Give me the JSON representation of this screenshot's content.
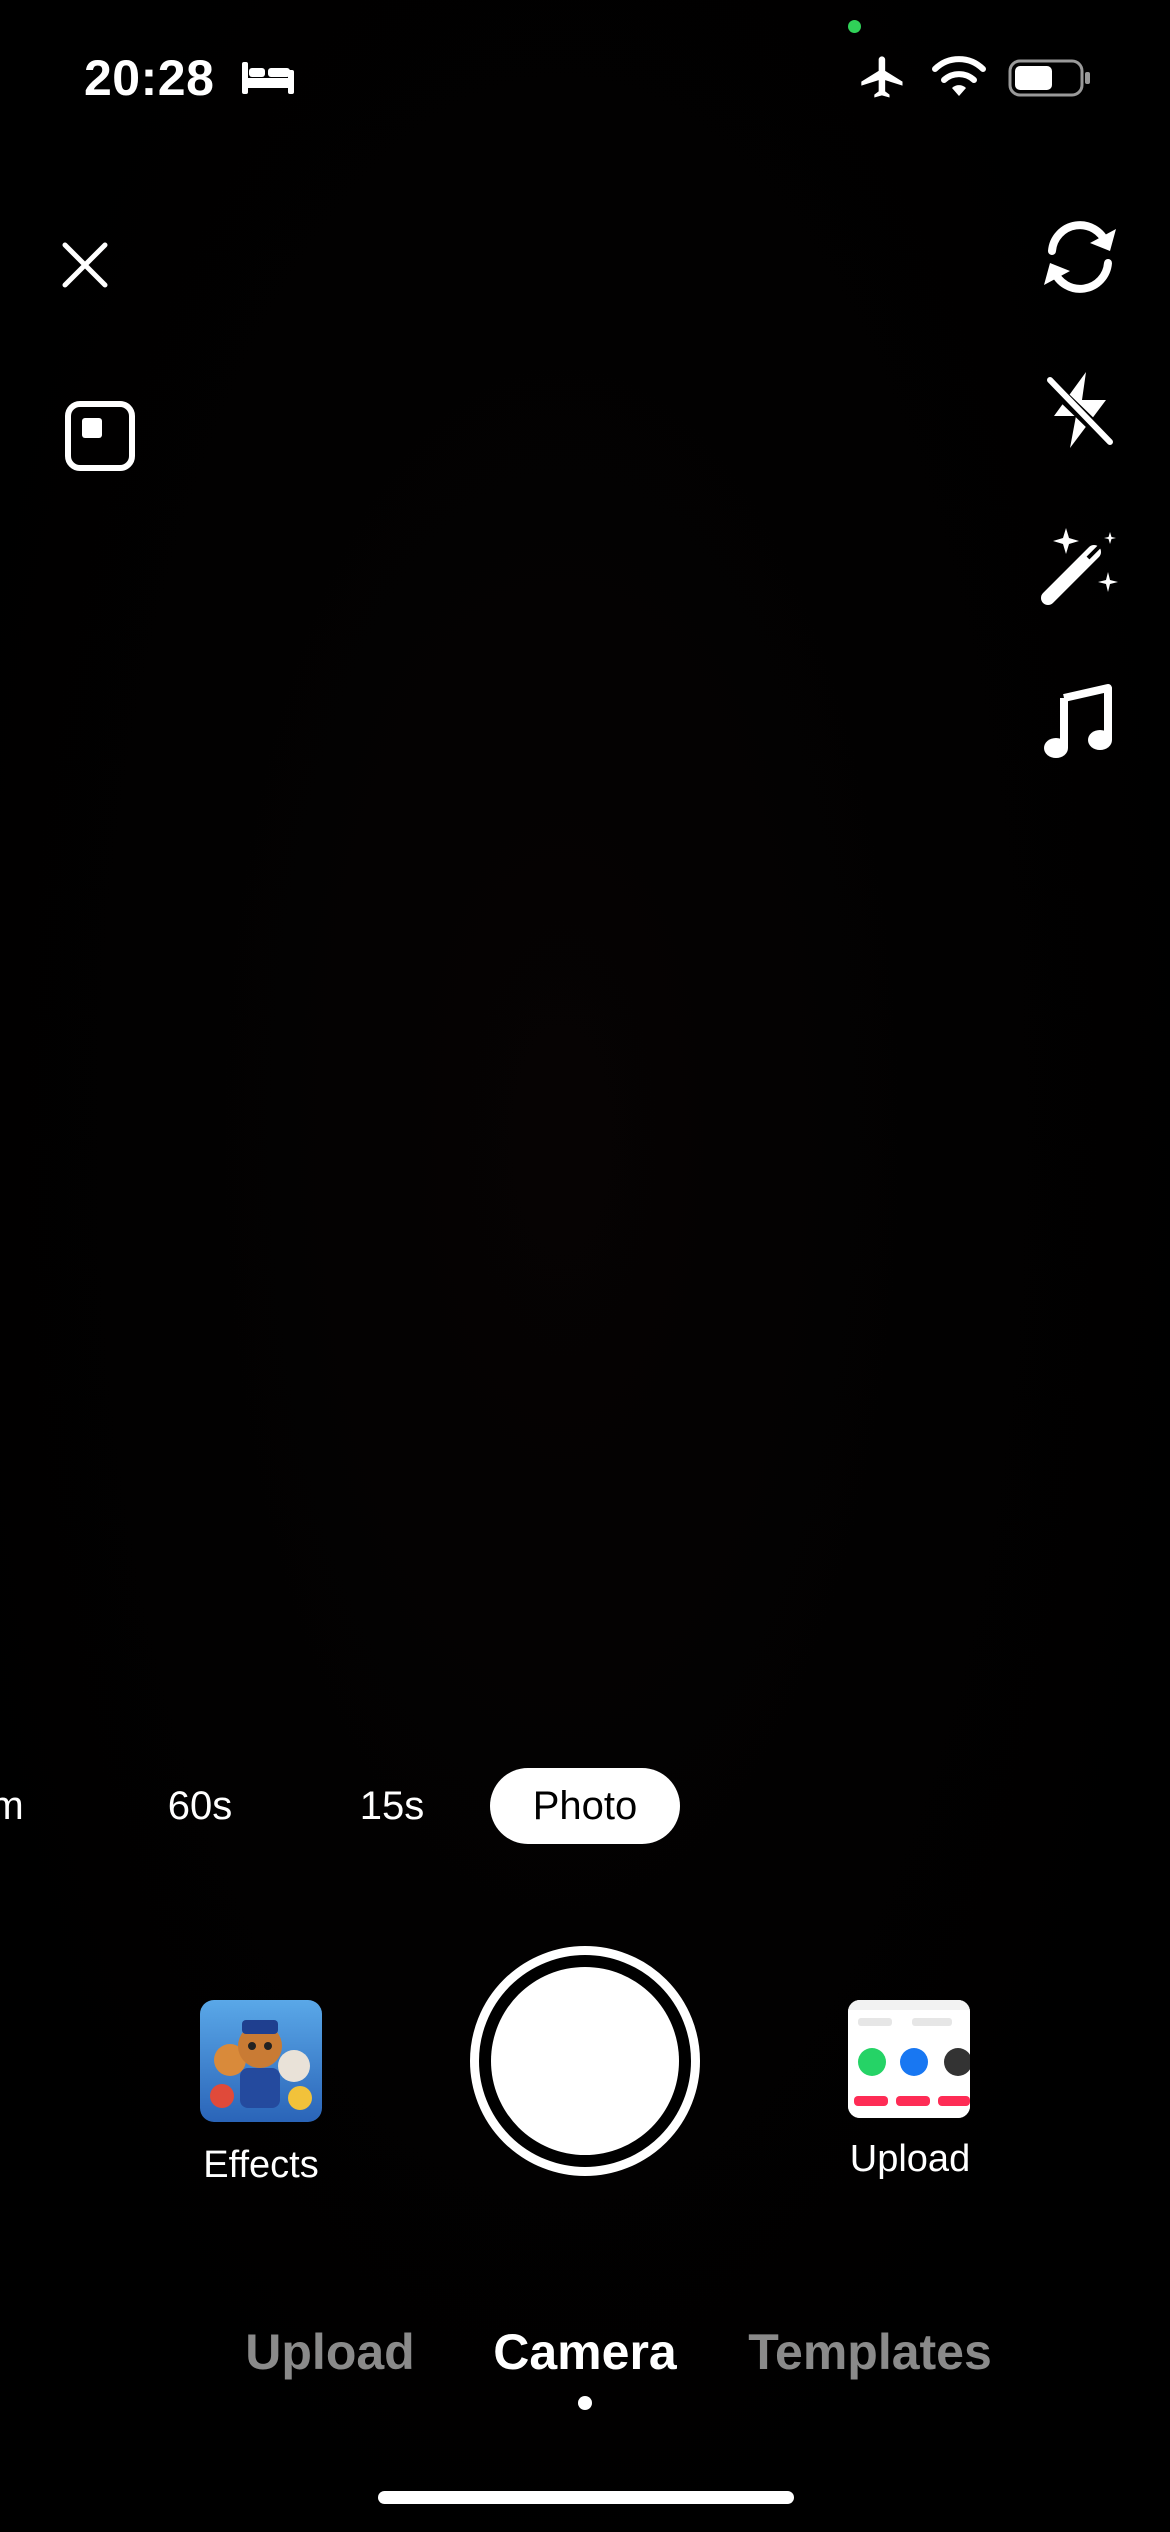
{
  "status_bar": {
    "time": "20:28",
    "sleep_icon": "bed-icon",
    "camera_indicator_color": "#30d158",
    "airplane_icon": "airplane-icon",
    "wifi_icon": "wifi-icon",
    "battery_icon": "battery-icon",
    "battery_level": 0.6
  },
  "top_controls": {
    "close_icon": "close-icon",
    "layout_icon": "layout-icon"
  },
  "side_toolbar": {
    "icons": [
      "flip-camera-icon",
      "flash-off-icon",
      "magic-wand-icon",
      "music-note-icon"
    ]
  },
  "modes": {
    "items": [
      "m",
      "60s",
      "15s",
      "Photo"
    ],
    "selected": "Photo"
  },
  "bottom_controls": {
    "effects_label": "Effects",
    "upload_label": "Upload",
    "shutter_icon": "shutter-button"
  },
  "tabs": {
    "items": [
      "Upload",
      "Camera",
      "Templates"
    ],
    "active": "Camera"
  },
  "colors": {
    "background": "#000000",
    "active_text": "#ffffff",
    "inactive_tab": "#8a8a8a"
  }
}
